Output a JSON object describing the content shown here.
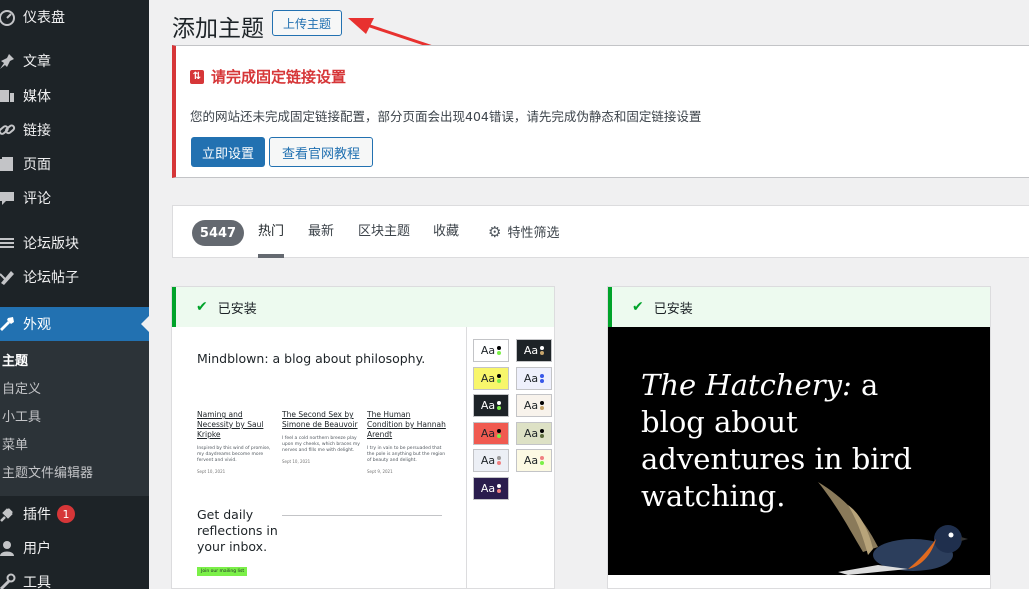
{
  "sidebar": {
    "items": [
      {
        "label": "仪表盘",
        "icon": "dashboard-icon"
      },
      {
        "label": "文章",
        "icon": "pin-icon"
      },
      {
        "label": "媒体",
        "icon": "media-icon"
      },
      {
        "label": "链接",
        "icon": "link-icon"
      },
      {
        "label": "页面",
        "icon": "page-icon"
      },
      {
        "label": "评论",
        "icon": "comment-icon"
      },
      {
        "label": "论坛版块",
        "icon": "forum-icon"
      },
      {
        "label": "论坛帖子",
        "icon": "forum-topic-icon"
      },
      {
        "label": "外观",
        "icon": "appearance-icon"
      },
      {
        "label": "插件",
        "icon": "plugin-icon"
      },
      {
        "label": "用户",
        "icon": "user-icon"
      },
      {
        "label": "工具",
        "icon": "tools-icon"
      }
    ],
    "plugin_badge": "1",
    "submenu": [
      "主题",
      "自定义",
      "小工具",
      "菜单",
      "主题文件编辑器"
    ]
  },
  "header": {
    "title": "添加主题",
    "upload_label": "上传主题"
  },
  "notice": {
    "title": "请完成固定链接设置",
    "text": "您的网站还未完成固定链接配置，部分页面会出现404错误，请先完成伪静态和固定链接设置",
    "btn_setup": "立即设置",
    "btn_tutorial": "查看官网教程"
  },
  "filter": {
    "count": "5447",
    "tabs": [
      "热门",
      "最新",
      "区块主题",
      "收藏",
      "特性筛选"
    ]
  },
  "cards": [
    {
      "status": "已安装",
      "preview_title": "Mindblown: a blog about philosophy.",
      "posts": [
        {
          "title": "Naming and Necessity by Saul Kripke",
          "excerpt": "Inspired by this wind of promise, my daydreams become more fervent and vivid.",
          "date": "Sept 10, 2021"
        },
        {
          "title": "The Second Sex by Simone de Beauvoir",
          "excerpt": "I feel a cold northern breeze play upon my cheeks, which braces my nerves and fills me with delight.",
          "date": "Sept 10, 2021"
        },
        {
          "title": "The Human Condition by Hannah Arendt",
          "excerpt": "I try in vain to be persuaded that the pole is anything but the region of beauty and delight.",
          "date": "Sept 9, 2021"
        }
      ],
      "daily_text": "Get daily reflections in your inbox.",
      "join_text": "Join our mailing list",
      "swatch_label": "Aa"
    },
    {
      "status": "已安装",
      "title_italic": "The Hatchery:",
      "title_rest": " a blog about adventures in bird watching."
    }
  ],
  "colors": {
    "sidebar_bg": "#1d2327",
    "accent": "#2271b1",
    "notice_red": "#d63638",
    "installed_green": "#00a32a"
  }
}
